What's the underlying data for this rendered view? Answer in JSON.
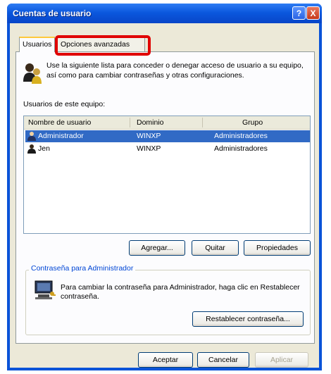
{
  "window": {
    "title": "Cuentas de usuario",
    "help_symbol": "?",
    "close_symbol": "X"
  },
  "tabs": [
    {
      "label": "Usuarios"
    },
    {
      "label": "Opciones avanzadas"
    }
  ],
  "intro_text": "Use la siguiente lista para conceder o denegar acceso de usuario a su equipo, así como para cambiar contraseñas y otras configuraciones.",
  "users_label": "Usuarios de este equipo:",
  "table": {
    "columns": [
      "Nombre de usuario",
      "Dominio",
      "Grupo"
    ],
    "rows": [
      {
        "name": "Administrador",
        "domain": "WINXP",
        "group": "Administradores"
      },
      {
        "name": "Jen",
        "domain": "WINXP",
        "group": "Administradores"
      }
    ]
  },
  "list_buttons": {
    "add": "Agregar...",
    "remove": "Quitar",
    "properties": "Propiedades"
  },
  "password_group": {
    "title": "Contraseña para Administrador",
    "text": "Para cambiar la contraseña para Administrador, haga clic en Restablecer contraseña.",
    "reset_button": "Restablecer contraseña..."
  },
  "dialog_buttons": {
    "ok": "Aceptar",
    "cancel": "Cancelar",
    "apply": "Aplicar"
  },
  "colors": {
    "titlebar": "#0b58de",
    "selection": "#316ac5",
    "highlight_box": "#e00000"
  },
  "icons": [
    "users-icon",
    "user-icon",
    "computer-key-icon",
    "help-icon",
    "close-icon"
  ]
}
